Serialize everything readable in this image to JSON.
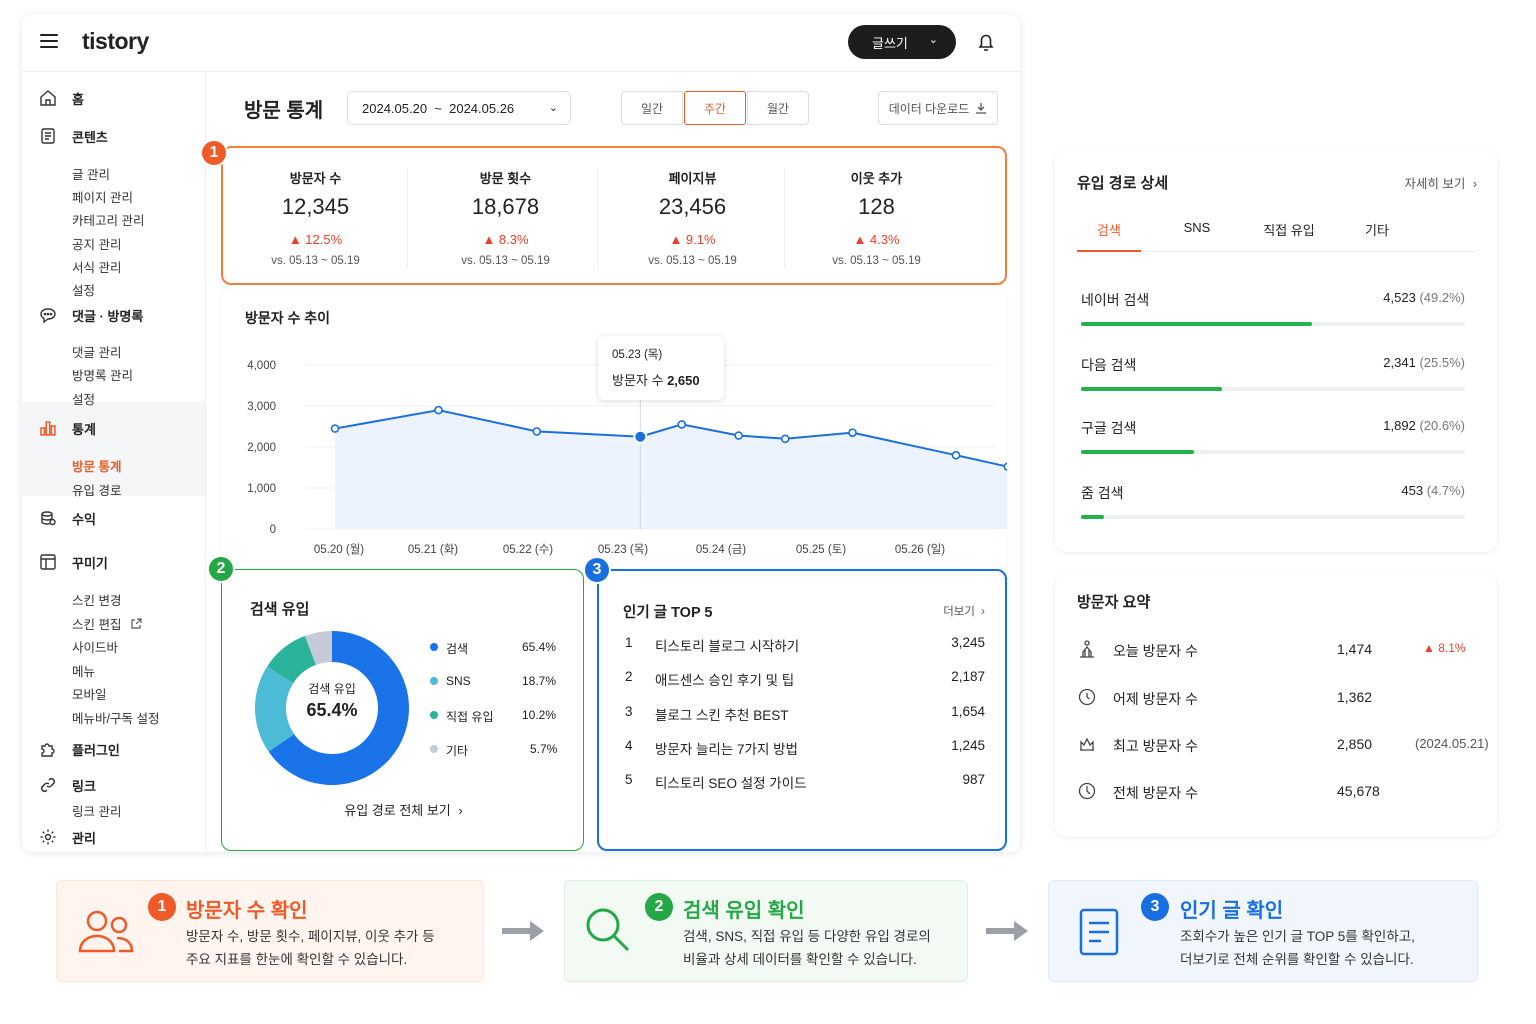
{
  "app": {
    "logo": "tistory",
    "write_label": "글쓰기"
  },
  "sidebar": {
    "home": "홈",
    "content": {
      "label": "콘텐츠",
      "items": [
        "글 관리",
        "페이지 관리",
        "카테고리 관리",
        "공지 관리",
        "서식 관리",
        "설정"
      ]
    },
    "comments": {
      "label": "댓글 · 방명록",
      "items": [
        "댓글 관리",
        "방명록 관리",
        "설정"
      ]
    },
    "stats": {
      "label": "통계",
      "items": [
        "방문 통계",
        "유입 경로"
      ]
    },
    "revenue": "수익",
    "decorate": {
      "label": "꾸미기",
      "items": [
        "스킨 변경",
        "스킨 편집",
        "사이드바",
        "메뉴",
        "모바일",
        "메뉴바/구독 설정"
      ]
    },
    "plugin": "플러그인",
    "link": {
      "label": "링크",
      "items": [
        "링크 관리"
      ]
    },
    "admin": "관리"
  },
  "header": {
    "title": "방문 통계",
    "date_range": "2024.05.20  ~  2024.05.26",
    "periods": [
      "일간",
      "주간",
      "월간"
    ],
    "active_period": "주간",
    "download": "데이터 다운로드"
  },
  "metrics": [
    {
      "label": "방문자 수",
      "value": "12,345",
      "change": "▲ 12.5%",
      "vs": "vs. 05.13 ~ 05.19"
    },
    {
      "label": "방문 횟수",
      "value": "18,678",
      "change": "▲ 8.3%",
      "vs": "vs. 05.13 ~ 05.19"
    },
    {
      "label": "페이지뷰",
      "value": "23,456",
      "change": "▲ 9.1%",
      "vs": "vs. 05.13 ~ 05.19"
    },
    {
      "label": "이웃 추가",
      "value": "128",
      "change": "▲ 4.3%",
      "vs": "vs. 05.13 ~ 05.19"
    }
  ],
  "badges": [
    "1",
    "2",
    "3"
  ],
  "chart_data": {
    "type": "line",
    "title": "방문자 수 추이",
    "x": [
      "05.20 (월)",
      "05.21 (화)",
      "05.22 (수)",
      "05.23 (목)",
      "05.24 (금)",
      "05.25 (토)",
      "05.26 (일)"
    ],
    "points": [
      {
        "d": 0,
        "v": 2450
      },
      {
        "d": 1.0,
        "v": 2900
      },
      {
        "d": 1.95,
        "v": 2380
      },
      {
        "d": 2.95,
        "v": 2250
      },
      {
        "d": 3.35,
        "v": 2550
      },
      {
        "d": 3.9,
        "v": 2280
      },
      {
        "d": 4.35,
        "v": 2200
      },
      {
        "d": 5.0,
        "v": 2350
      },
      {
        "d": 6.0,
        "v": 1800
      },
      {
        "d": 6.5,
        "v": 1520
      }
    ],
    "yticks": [
      "4,000",
      "3,000",
      "2,000",
      "1,000",
      "0"
    ],
    "ylim": [
      0,
      4000
    ],
    "highlight_index": 3,
    "tooltip": {
      "date": "05.23 (목)",
      "label": "방문자 수",
      "value": "2,650"
    },
    "color": "#1a6fe0",
    "grid": true
  },
  "search_inflow": {
    "title": "검색 유입",
    "center_label": "검색 유입",
    "center_value": "65.4%",
    "legend": [
      {
        "name": "검색",
        "value": "65.4%",
        "pct": 65.4,
        "color": "#1a73e8"
      },
      {
        "name": "SNS",
        "value": "18.7%",
        "pct": 18.7,
        "color": "#4bbbd6"
      },
      {
        "name": "직접 유입",
        "value": "10.2%",
        "pct": 10.2,
        "color": "#2bb39a"
      },
      {
        "name": "기타",
        "value": "5.7%",
        "pct": 5.7,
        "color": "#c5cbd6"
      }
    ],
    "footer": "유입 경로 전체 보기"
  },
  "top_posts": {
    "title": "인기 글 TOP 5",
    "more": "더보기",
    "rows": [
      {
        "rank": "1",
        "title": "티스토리 블로그 시작하기",
        "views": "3,245"
      },
      {
        "rank": "2",
        "title": "애드센스 승인 후기 및 팁",
        "views": "2,187"
      },
      {
        "rank": "3",
        "title": "블로그 스킨 추천 BEST",
        "views": "1,654"
      },
      {
        "rank": "4",
        "title": "방문자 늘리는 7가지 방법",
        "views": "1,245"
      },
      {
        "rank": "5",
        "title": "티스토리 SEO 설정 가이드",
        "views": "987"
      }
    ]
  },
  "inflow_detail": {
    "title": "유입 경로 상세",
    "more": "자세히 보기",
    "tabs": [
      "검색",
      "SNS",
      "직접 유입",
      "기타"
    ],
    "active_tab": "검색",
    "rows": [
      {
        "name": "네이버 검색",
        "count": "4,523",
        "pct": "(49.2%)",
        "ratio": 0.602
      },
      {
        "name": "다음 검색",
        "count": "2,341",
        "pct": "(25.5%)",
        "ratio": 0.367
      },
      {
        "name": "구글 검색",
        "count": "1,892",
        "pct": "(20.6%)",
        "ratio": 0.295
      },
      {
        "name": "줌 검색",
        "count": "453",
        "pct": "(4.7%)",
        "ratio": 0.06
      }
    ]
  },
  "visitor_summary": {
    "title": "방문자 요약",
    "rows": [
      {
        "name": "오늘 방문자 수",
        "value": "1,474",
        "extra": "▲ 8.1%"
      },
      {
        "name": "어제 방문자 수",
        "value": "1,362",
        "extra": ""
      },
      {
        "name": "최고 방문자 수",
        "value": "2,850",
        "extra": "(2024.05.21)"
      },
      {
        "name": "전체 방문자 수",
        "value": "45,678",
        "extra": ""
      }
    ]
  },
  "steps": [
    {
      "num": "1",
      "title": "방문자 수 확인",
      "desc1": "방문자 수, 방문 횟수, 페이지뷰, 이웃 추가 등",
      "desc2": "주요 지표를 한눈에 확인할 수 있습니다."
    },
    {
      "num": "2",
      "title": "검색 유입 확인",
      "desc1": "검색, SNS, 직접 유입 등 다양한 유입 경로의",
      "desc2": "비율과 상세 데이터를 확인할 수 있습니다."
    },
    {
      "num": "3",
      "title": "인기 글 확인",
      "desc1": "조회수가 높은 인기 글 TOP 5를 확인하고,",
      "desc2": "더보기로 전체 순위를 확인할 수 있습니다."
    }
  ],
  "colors": {
    "orange": "#f05a28",
    "green": "#23a845",
    "blue": "#1a6fe0",
    "red": "#e8402a"
  }
}
